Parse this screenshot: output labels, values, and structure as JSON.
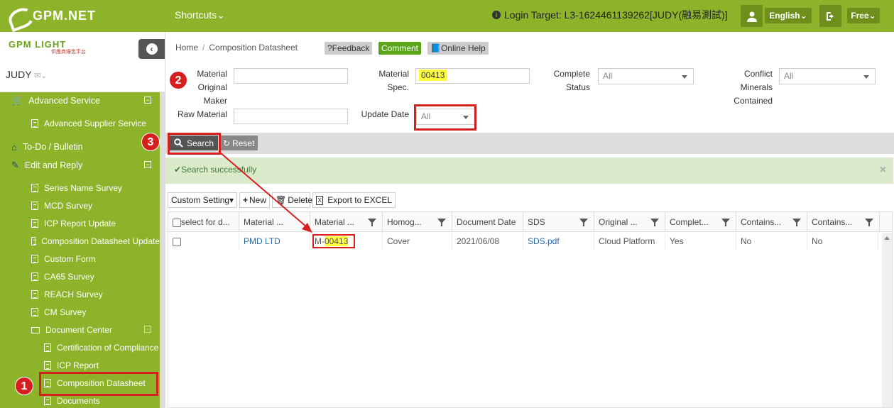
{
  "topbar": {
    "logo_text": "GPM.NET",
    "shortcuts": "Shortcuts",
    "login_target": "Login Target: L3-1624461139262[JUDY(融易測試)]",
    "language": "English",
    "plan": "Free"
  },
  "sidebar": {
    "logo_text": "GPM LIGHT",
    "logo_sub": "供應商綠色平台",
    "user": "JUDY",
    "items": [
      {
        "label": "Advanced Service"
      },
      {
        "label": "Advanced Supplier Service"
      },
      {
        "label": "To-Do / Bulletin"
      },
      {
        "label": "Edit and Reply"
      },
      {
        "label": "Series Name Survey"
      },
      {
        "label": "MCD Survey"
      },
      {
        "label": "ICP Report Update"
      },
      {
        "label": "Composition Datasheet Update"
      },
      {
        "label": "Custom Form"
      },
      {
        "label": "CA65 Survey"
      },
      {
        "label": "REACH Survey"
      },
      {
        "label": "CM Survey"
      },
      {
        "label": "Document Center"
      },
      {
        "label": "Certification of Compliance"
      },
      {
        "label": "ICP Report"
      },
      {
        "label": "Composition Datasheet"
      },
      {
        "label": "Documents"
      }
    ]
  },
  "breadcrumb": {
    "home": "Home",
    "current": "Composition Datasheet"
  },
  "header_buttons": {
    "feedback": "?Feedback",
    "comment": "Comment",
    "help": "Online Help"
  },
  "form": {
    "maker_label": "Material Original Maker",
    "raw_label": "Raw Material",
    "spec_label": "Material Spec.",
    "spec_value": "00413",
    "update_label": "Update Date",
    "update_value": "All",
    "complete_label": "Complete Status",
    "complete_value": "All",
    "conflict_label": "Conflict Minerals Contained",
    "conflict_value": "All"
  },
  "actions": {
    "search": "Search",
    "reset": "Reset"
  },
  "alert": {
    "message": "Search successfully"
  },
  "grid_tools": {
    "custom": "Custom Setting",
    "new": "New",
    "delete": "Delete",
    "export": "Export to EXCEL"
  },
  "grid": {
    "headers": [
      "select for d...",
      "Material ...",
      "Material ...",
      "Homog...",
      "Document Date",
      "SDS",
      "Original ...",
      "Complet...",
      "Contains...",
      "Contains..."
    ],
    "row": {
      "maker": "PMD LTD",
      "spec_prefix": "M-",
      "spec_hl": "00413",
      "homog": "Cover",
      "date": "2021/06/08",
      "sds": "SDS.pdf",
      "original": "Cloud Platform",
      "complete": "Yes",
      "contains1": "No",
      "contains2": "No"
    }
  },
  "callouts": {
    "one": "1",
    "two": "2",
    "three": "3"
  },
  "colors": {
    "brand": "#8db32a",
    "highlight": "#d62020",
    "match": "#ffff3c"
  }
}
